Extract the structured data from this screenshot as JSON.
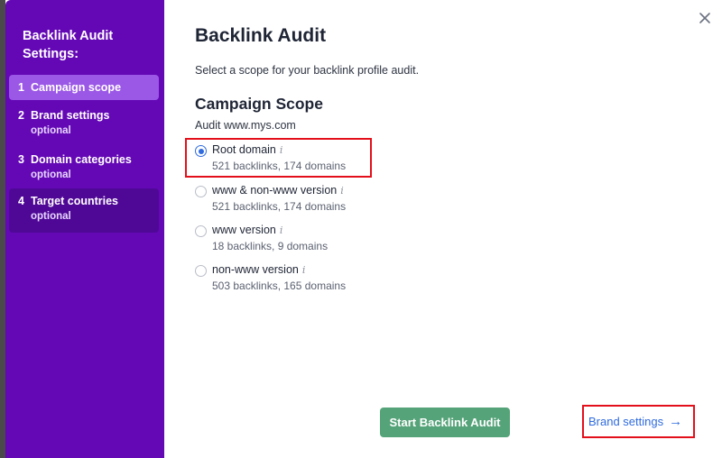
{
  "sidebar": {
    "title": "Backlink Audit Settings:",
    "steps": [
      {
        "num": "1",
        "label": "Campaign scope",
        "sub": ""
      },
      {
        "num": "2",
        "label": "Brand settings",
        "sub": "optional"
      },
      {
        "num": "3",
        "label": "Domain categories",
        "sub": "optional"
      },
      {
        "num": "4",
        "label": "Target countries",
        "sub": "optional"
      }
    ]
  },
  "main": {
    "title": "Backlink Audit",
    "description": "Select a scope for your backlink profile audit.",
    "section_title": "Campaign Scope",
    "audit_domain": "Audit www.mys.com",
    "info_glyph": "i",
    "options": [
      {
        "label": "Root domain",
        "sub": "521 backlinks, 174 domains",
        "selected": true
      },
      {
        "label": "www & non-www version",
        "sub": "521 backlinks, 174 domains",
        "selected": false
      },
      {
        "label": "www version",
        "sub": "18 backlinks, 9 domains",
        "selected": false
      },
      {
        "label": "non-www version",
        "sub": "503 backlinks, 165 domains",
        "selected": false
      }
    ]
  },
  "footer": {
    "start_button": "Start Backlink Audit",
    "next_link": "Brand settings",
    "next_arrow": "→"
  },
  "colors": {
    "sidebar": "#6408b5",
    "accent_blue": "#2f6bde",
    "start_green": "#55a379",
    "highlight_red": "#e3101b"
  }
}
